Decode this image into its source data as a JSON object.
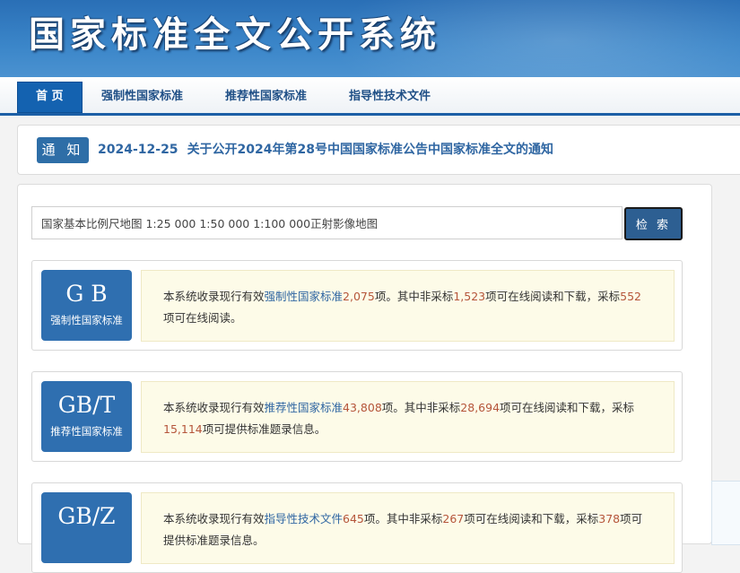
{
  "site": {
    "title": "国家标准全文公开系统"
  },
  "nav": {
    "items": [
      {
        "label": "首 页",
        "active": true
      },
      {
        "label": "强制性国家标准"
      },
      {
        "label": "推荐性国家标准"
      },
      {
        "label": "指导性技术文件"
      }
    ]
  },
  "notice": {
    "badge": "通 知",
    "date": "2024-12-25",
    "text": "关于公开2024年第28号中国国家标准公告中国家标准全文的通知"
  },
  "search": {
    "value": "国家基本比例尺地图 1:25 000 1:50 000 1:100 000正射影像地图",
    "button": "检 索"
  },
  "cards": [
    {
      "code": "G B",
      "label": "强制性国家标准",
      "desc": {
        "t1": "本系统收录现行有效",
        "hl": "强制性国家标准",
        "n1": "2,075",
        "t2": "项。其中非采标",
        "n2": "1,523",
        "t3": "项可在线阅读和下载，采标",
        "n3": "552",
        "t4": "项可在线阅读。"
      }
    },
    {
      "code": "GB/T",
      "label": "推荐性国家标准",
      "desc": {
        "t1": "本系统收录现行有效",
        "hl": "推荐性国家标准",
        "n1": "43,808",
        "t2": "项。其中非采标",
        "n2": "28,694",
        "t3": "项可在线阅读和下载，采标",
        "n3": "15,114",
        "t4": "项可提供标准题录信息。"
      }
    },
    {
      "code": "GB/Z",
      "label": "",
      "desc": {
        "t1": "本系统收录现行有效",
        "hl": "指导性技术文件",
        "n1": "645",
        "t2": "项。其中非采标",
        "n2": "267",
        "t3": "项可在线阅读和下载，采标",
        "n3": "378",
        "t4": "项可提供标准题录信息。"
      }
    }
  ]
}
